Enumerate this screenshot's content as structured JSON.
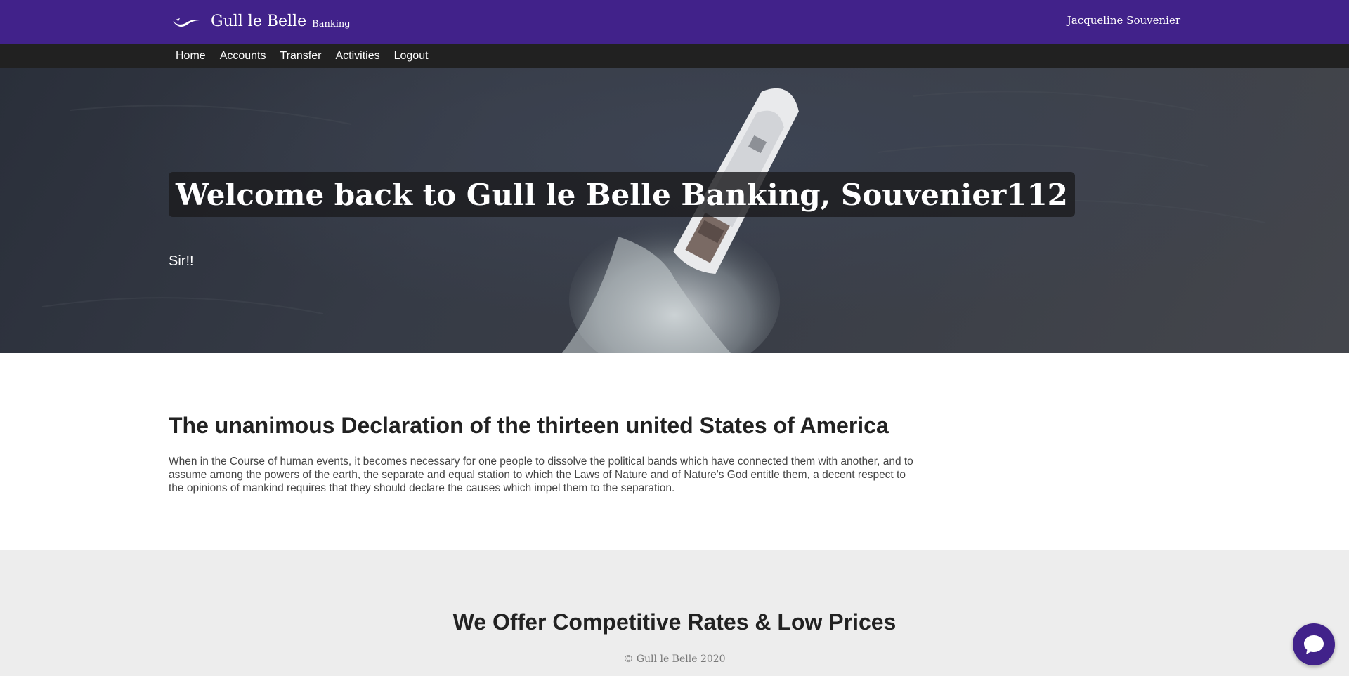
{
  "brand": {
    "name": "Gull le Belle",
    "sub": "Banking",
    "logo_icon": "seagull-icon"
  },
  "header": {
    "user_name": "Jacqueline Souvenier"
  },
  "nav": {
    "items": [
      "Home",
      "Accounts",
      "Transfer",
      "Activities",
      "Logout"
    ]
  },
  "hero": {
    "title": "Welcome back to Gull le Belle Banking, Souvenier112",
    "subtitle": "Sir!!"
  },
  "declaration": {
    "heading": "The unanimous Declaration of the thirteen united States of America",
    "text": "When in the Course of human events, it becomes necessary for one people to dissolve the political bands which have connected them with another, and to assume among the powers of the earth, the separate and equal station to which the Laws of Nature and of Nature's God entitle them, a decent respect to the opinions of mankind requires that they should declare the causes which impel them to the separation."
  },
  "rates": {
    "heading": "We Offer Competitive Rates & Low Prices",
    "copyright": "© Gull le Belle 2020"
  },
  "chat": {
    "icon": "chat-bubble-icon"
  },
  "colors": {
    "brand_purple": "#41228a",
    "nav_dark": "#212121",
    "section_gray": "#ededed"
  }
}
